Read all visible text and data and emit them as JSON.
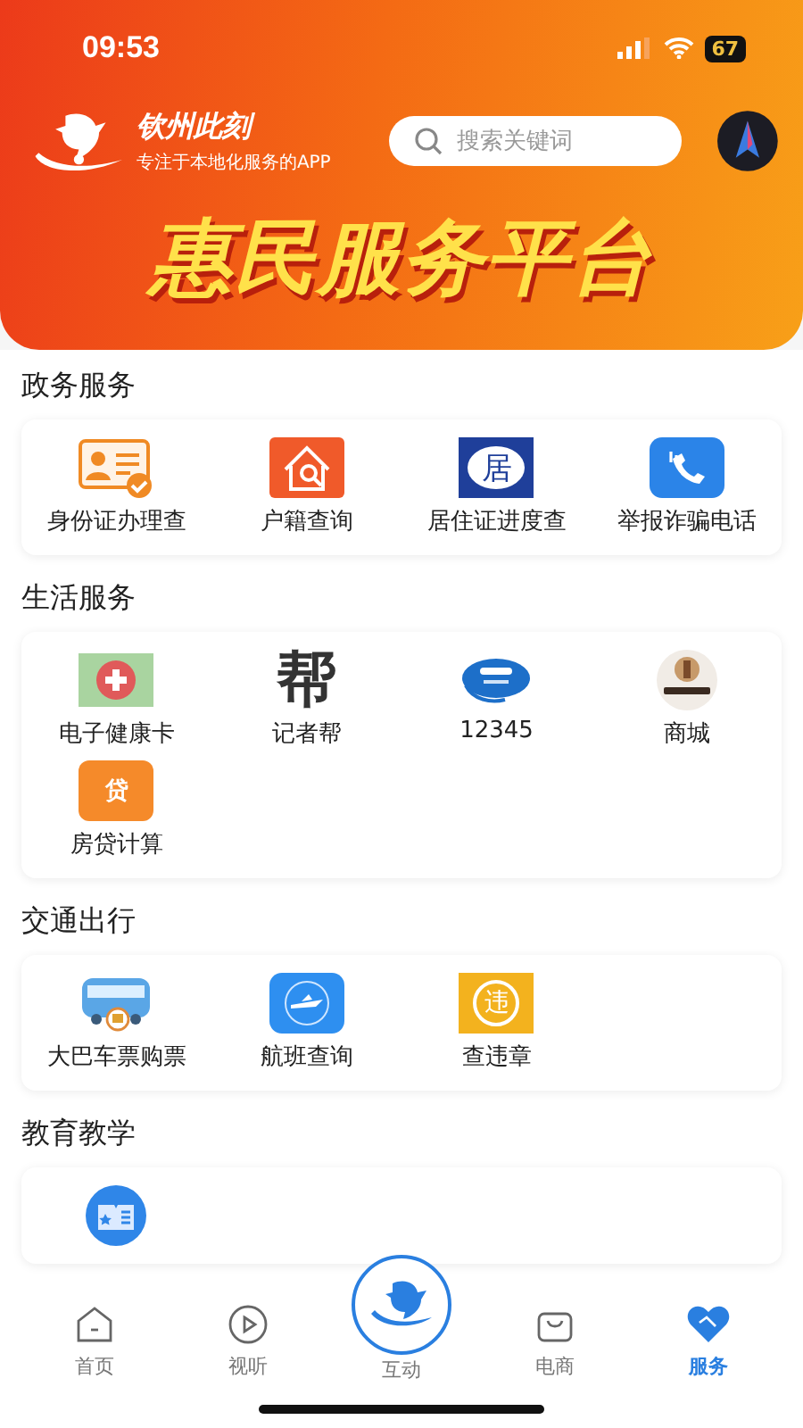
{
  "status_bar": {
    "time": "09:53",
    "battery": "67"
  },
  "header": {
    "app_name": "钦州此刻",
    "slogan": "专注于本地化服务的APP",
    "search": {
      "placeholder": "搜索关键词"
    },
    "banner_title": "惠民服务平台"
  },
  "sections": [
    {
      "title": "政务服务",
      "items": [
        {
          "label": "身份证办理查"
        },
        {
          "label": "户籍查询"
        },
        {
          "label": "居住证进度查",
          "icon_text": "居"
        },
        {
          "label": "举报诈骗电话"
        }
      ]
    },
    {
      "title": "生活服务",
      "items": [
        {
          "label": "电子健康卡"
        },
        {
          "label": "记者帮",
          "icon_text": "帮"
        },
        {
          "label": "12345"
        },
        {
          "label": "商城"
        },
        {
          "label": "房贷计算",
          "icon_text": "贷"
        }
      ]
    },
    {
      "title": "交通出行",
      "items": [
        {
          "label": "大巴车票购票"
        },
        {
          "label": "航班查询"
        },
        {
          "label": "查违章",
          "icon_text": "违"
        }
      ]
    },
    {
      "title": "教育教学",
      "items": [
        {
          "kind": "icon_only"
        }
      ]
    }
  ],
  "tab_bar": [
    {
      "label": "首页",
      "kind": "normal",
      "selected": false
    },
    {
      "label": "视听",
      "kind": "normal",
      "selected": false
    },
    {
      "label": "互动",
      "kind": "center",
      "selected": false
    },
    {
      "label": "电商",
      "kind": "normal",
      "selected": false
    },
    {
      "label": "服务",
      "kind": "normal",
      "selected": true
    }
  ]
}
